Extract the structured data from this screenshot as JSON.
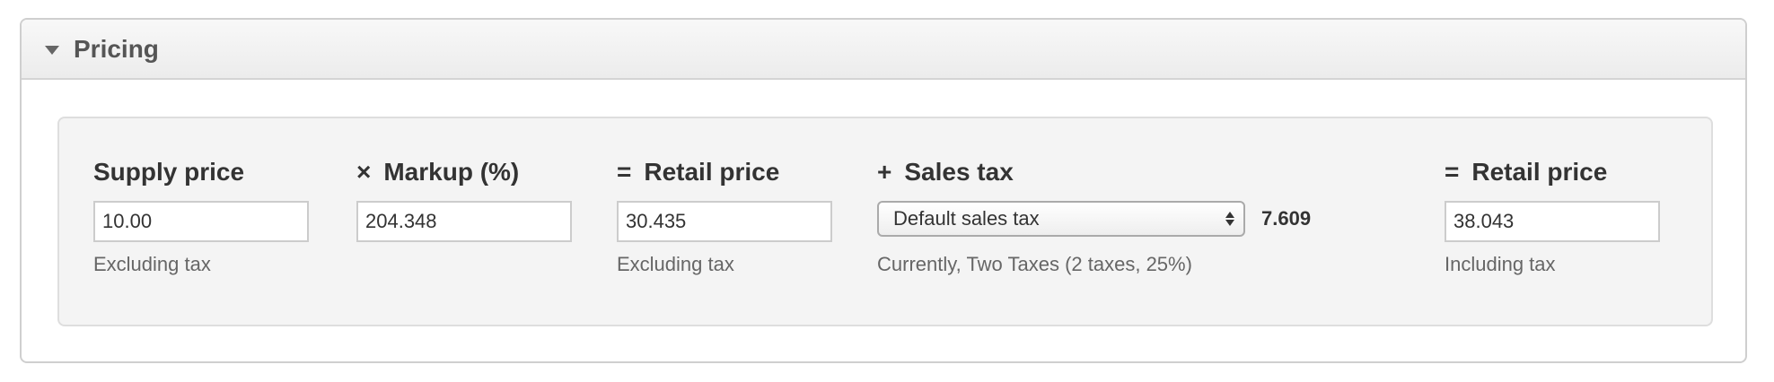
{
  "panel": {
    "title": "Pricing"
  },
  "fields": {
    "supply_price": {
      "operator": "",
      "label": "Supply price",
      "value": "10.00",
      "help": "Excluding tax"
    },
    "markup": {
      "operator": "×",
      "label": "Markup (%)",
      "value": "204.348",
      "help": ""
    },
    "retail_price_ex": {
      "operator": "=",
      "label": "Retail price",
      "value": "30.435",
      "help": "Excluding tax"
    },
    "sales_tax": {
      "operator": "+",
      "label": "Sales tax",
      "selected": "Default sales tax",
      "amount": "7.609",
      "help": "Currently, Two Taxes (2 taxes, 25%)"
    },
    "retail_price_inc": {
      "operator": "=",
      "label": "Retail price",
      "value": "38.043",
      "help": "Including tax"
    }
  },
  "icons": {
    "collapse": "caret-down-icon",
    "select": "select-arrows-icon"
  }
}
